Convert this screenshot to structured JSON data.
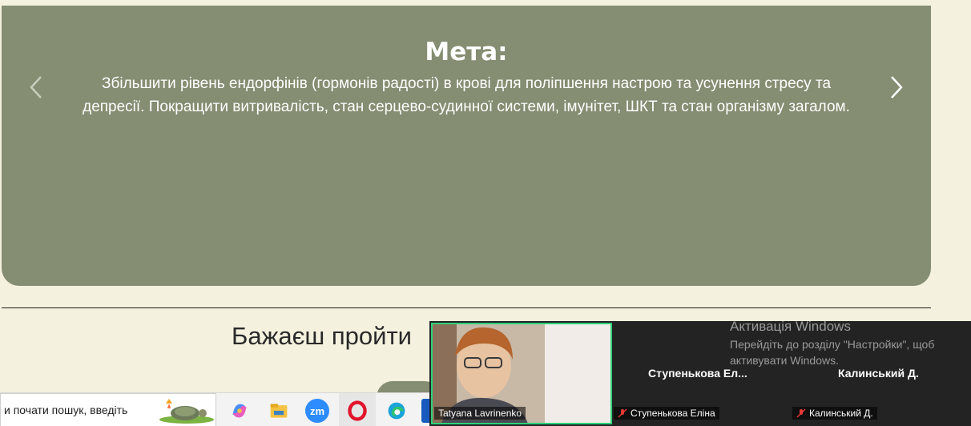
{
  "carousel": {
    "title": "Мета:",
    "text": "Збільшити рівень ендорфінів (гормонів радості) в крові для поліпшення настрою та усунення стресу та депресії. Покращити витривалість, стан серцево-судинної системи, імунітет, ШКТ та стан організму загалом.",
    "prev_icon": "chevron-left-icon",
    "next_icon": "chevron-right-icon",
    "bg_color": "#858d72"
  },
  "cta": {
    "heading": "Бажаєш пройти"
  },
  "taskbar": {
    "search_text": "и почати пошук, введіть",
    "apps": [
      {
        "name": "copilot-icon"
      },
      {
        "name": "file-explorer-icon"
      },
      {
        "name": "zoom-icon",
        "label": "zm"
      },
      {
        "name": "opera-icon"
      },
      {
        "name": "edge-icon"
      }
    ]
  },
  "zoom": {
    "self_name": "Tatyana Lavrinenko",
    "participants": [
      {
        "big_name": "Ступенькова   Ел...",
        "label": "Ступенькова Еліна"
      },
      {
        "big_name": "Калинський Д.",
        "label": "Калинський Д."
      }
    ]
  },
  "windows_activation": {
    "title": "Активація Windows",
    "message": "Перейдіть до розділу \"Настройки\", щоб активувати Windows."
  }
}
